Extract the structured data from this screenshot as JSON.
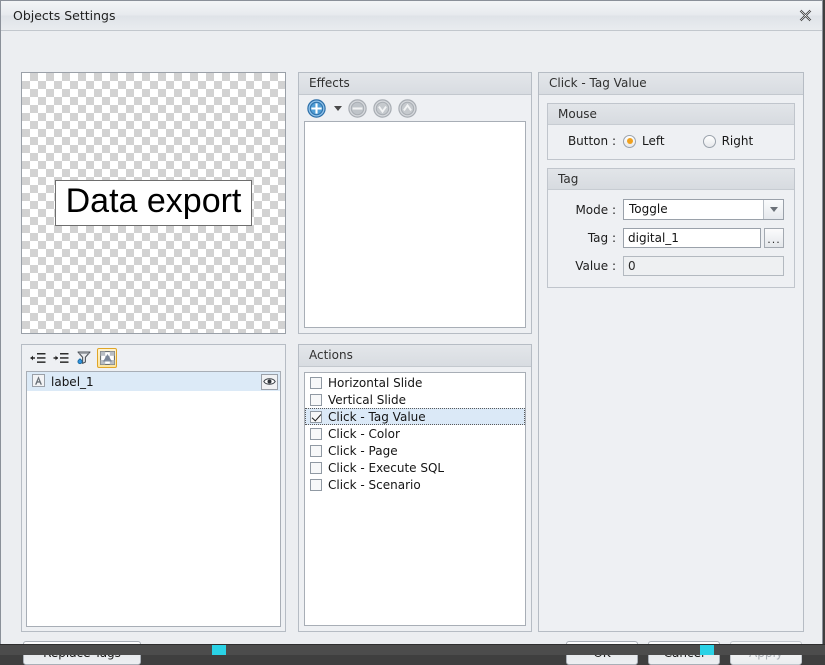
{
  "window": {
    "title": "Objects Settings",
    "close_icon": "close-icon"
  },
  "preview": {
    "label_text": "Data export"
  },
  "object_tree": {
    "toolbar": [
      {
        "icon": "collapse-all-icon",
        "active": false
      },
      {
        "icon": "expand-all-icon",
        "active": false
      },
      {
        "icon": "filter-icon",
        "active": false
      },
      {
        "icon": "transparency-icon",
        "active": true
      }
    ],
    "items": [
      {
        "icon": "label-object-icon",
        "name": "label_1",
        "visibility_icon": "eye-icon"
      }
    ]
  },
  "effects": {
    "title": "Effects",
    "toolbar": [
      {
        "icon": "add-effect-icon",
        "enabled": true
      },
      {
        "icon": "remove-effect-icon",
        "enabled": false
      },
      {
        "icon": "move-down-icon",
        "enabled": false
      },
      {
        "icon": "move-up-icon",
        "enabled": false
      }
    ],
    "items": []
  },
  "actions": {
    "title": "Actions",
    "items": [
      {
        "label": "Horizontal Slide",
        "checked": false,
        "selected": false
      },
      {
        "label": "Vertical Slide",
        "checked": false,
        "selected": false
      },
      {
        "label": "Click - Tag Value",
        "checked": true,
        "selected": true
      },
      {
        "label": "Click - Color",
        "checked": false,
        "selected": false
      },
      {
        "label": "Click - Page",
        "checked": false,
        "selected": false
      },
      {
        "label": "Click - Execute SQL",
        "checked": false,
        "selected": false
      },
      {
        "label": "Click - Scenario",
        "checked": false,
        "selected": false
      }
    ]
  },
  "properties": {
    "title": "Click - Tag Value",
    "mouse": {
      "title": "Mouse",
      "button_label": "Button :",
      "options": [
        {
          "label": "Left",
          "selected": true
        },
        {
          "label": "Right",
          "selected": false
        }
      ]
    },
    "tag": {
      "title": "Tag",
      "mode_label": "Mode :",
      "mode_value": "Toggle",
      "tag_label": "Tag :",
      "tag_value": "digital_1",
      "browse_label": "...",
      "value_label": "Value :",
      "value_value": "0"
    }
  },
  "footer": {
    "replace_tags": "Replace Tags",
    "ok": "OK",
    "cancel": "Cancel",
    "apply": "Apply"
  },
  "colors": {
    "accent_radio": "#f0a11e",
    "selection": "#dbe9f7",
    "panel": "#eef0f3",
    "toolbar_active_border": "#e0a526"
  }
}
